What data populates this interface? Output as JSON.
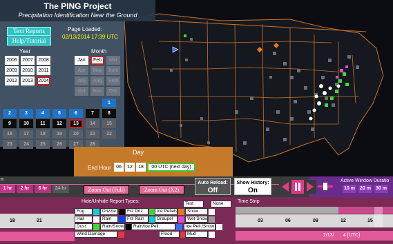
{
  "header": {
    "title": "The PING Project",
    "subtitle": "Precipitation Identification Near the Ground"
  },
  "controls": {
    "text_reports": "Text Reports",
    "help": "Help/Tutorial",
    "page_loaded_label": "Page Loaded:",
    "page_loaded_time": "02/13/2014 17:39 UTC"
  },
  "calendar": {
    "year_head": "Year",
    "month_head": "Month",
    "years": [
      "2006",
      "2007",
      "2008",
      "2009",
      "2010",
      "2011",
      "2012",
      "2013",
      "2014"
    ],
    "months": [
      "Jan",
      "Feb",
      "Mar",
      "Apr",
      "May",
      "June",
      "July",
      "Aug",
      "Sept",
      "Oct",
      "Nov",
      "Dec"
    ],
    "days": [
      "1",
      "2",
      "3",
      "4",
      "5",
      "6",
      "7",
      "8",
      "9",
      "10",
      "11",
      "12",
      "13",
      "14",
      "15",
      "16",
      "17",
      "18",
      "19",
      "20",
      "21",
      "22",
      "23",
      "24",
      "25",
      "26",
      "27",
      "28"
    ],
    "selected_year": "2014",
    "selected_month": "Feb",
    "selected_day": "13"
  },
  "day_panel": {
    "day_label": "Day",
    "end_hour_label": "End Hour",
    "hours": [
      "06",
      "12",
      "18",
      "00 UTC (next day)"
    ],
    "selected_hour": "00 UTC (next day)"
  },
  "timebar": {
    "range_buttons": [
      "1 hr",
      "2 hr",
      "6 hr",
      "24 hr"
    ],
    "zoom_full": "Zoom Out (Full)",
    "zoom_x2": "Zoom Out (X2)",
    "auto_reload_label": "Auto Reload:",
    "auto_reload_value": "Off",
    "show_history_label": "Show History:",
    "show_history_value": "On",
    "active_window_label": "Active Window Duratio",
    "window_buttons": [
      "10 m",
      "20 m",
      "30 m"
    ],
    "left_edge_text": "n"
  },
  "report_types": {
    "title": "Hide/Unhide Report Types:",
    "rows": [
      [
        "Fog",
        "Drizzle",
        "Frz Driz",
        "Ice Pellets",
        "Snow"
      ],
      [
        "Hail",
        "Rain",
        "Frz Rain",
        "Graupel",
        "Wet Snow"
      ],
      [
        "Dust",
        "Rain/Snow",
        "Rain/Ice Pell.",
        "Ice Pell./Snow"
      ],
      [
        "Wind Damage",
        "Flood",
        "Mud"
      ]
    ],
    "test_label": "Test",
    "none_label": "None"
  },
  "time_strip": {
    "title": "Time Strip",
    "left_ticks": [
      "18",
      "21"
    ],
    "ticks": [
      "03",
      "06",
      "09",
      "12",
      "15"
    ],
    "date_label": "2/13/",
    "utc_label": "4 [UTC]"
  },
  "colors": {
    "map_bg": "#0b0d12",
    "state_border": "#c8742a",
    "panel_orange": "#c57a2a",
    "bottom_magenta": "#7a2a55",
    "accent_pink": "#e26a98",
    "accent_cyan": "#2ec4c4"
  }
}
